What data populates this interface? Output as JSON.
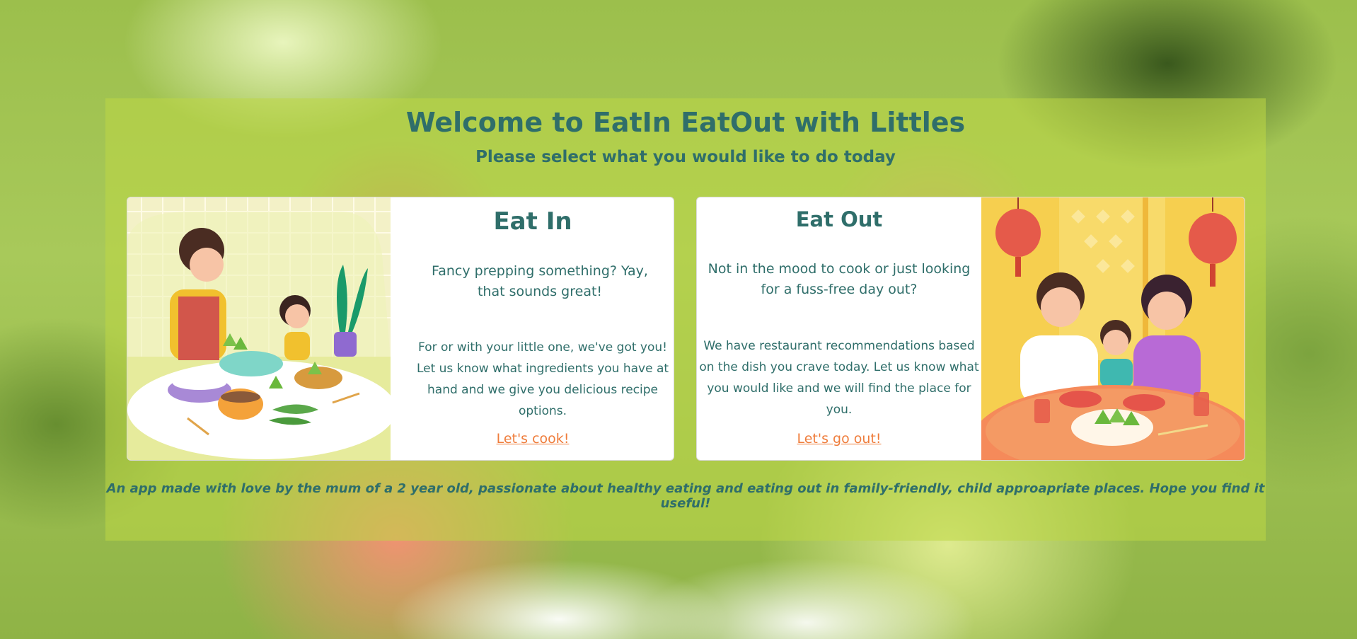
{
  "header": {
    "title": "Welcome to EatIn EatOut with Littles",
    "subtitle": "Please select what you would like to do today"
  },
  "cards": {
    "eat_in": {
      "title": "Eat In",
      "lead": "Fancy prepping something? Yay, that sounds great!",
      "body": "For or with your little one, we've got you! Let us know what ingredients you have at hand and we give you delicious recipe options.",
      "link": "Let's cook!"
    },
    "eat_out": {
      "title": "Eat Out",
      "lead": "Not in the mood to cook or just looking for a fuss-free day out?",
      "body": "We have restaurant recommendations based on the dish you crave today. Let us know what you would like and we will find the place for you.",
      "link": "Let's go out!"
    }
  },
  "footer": {
    "note": "An app made with love by the mum of a 2 year old, passionate about healthy eating and eating out in family-friendly, child approapriate places. Hope you find it useful!"
  },
  "colors": {
    "heading": "#2f6e6a",
    "link": "#ef7d3c",
    "overlay": "#bed746"
  }
}
